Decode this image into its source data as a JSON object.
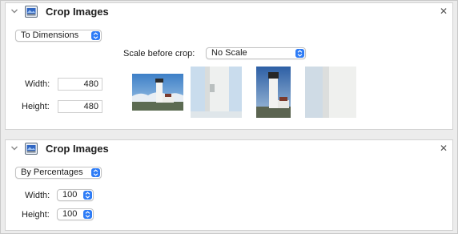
{
  "panel1": {
    "title": "Crop Images",
    "close_glyph": "✕",
    "mode_popup": "To Dimensions",
    "scale_label": "Scale before crop:",
    "scale_popup": "No Scale",
    "width_label": "Width:",
    "width_value": "480",
    "height_label": "Height:",
    "height_value": "480"
  },
  "panel2": {
    "title": "Crop Images",
    "close_glyph": "✕",
    "mode_popup": "By Percentages",
    "width_label": "Width:",
    "width_value": "100",
    "height_label": "Height:",
    "height_value": "100"
  },
  "icons": {
    "collapse": "chevron-down-icon",
    "app": "preview-app-icon",
    "close": "close-icon",
    "popup_arrows": "up-down-arrows-icon"
  },
  "colors": {
    "accent": "#2e7cf6",
    "panel_bg": "#ffffff",
    "window_bg": "#ececec"
  }
}
